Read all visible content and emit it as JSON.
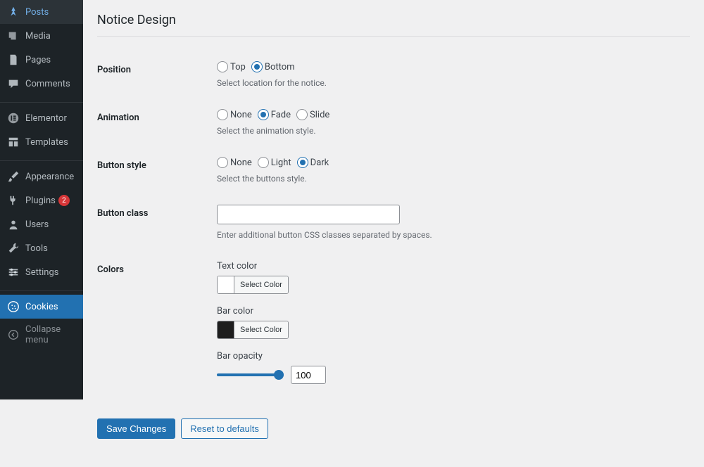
{
  "sidebar": {
    "items": [
      {
        "label": "Posts",
        "icon": "pin"
      },
      {
        "label": "Media",
        "icon": "media"
      },
      {
        "label": "Pages",
        "icon": "page"
      },
      {
        "label": "Comments",
        "icon": "comment"
      }
    ],
    "items2": [
      {
        "label": "Elementor",
        "icon": "elementor"
      },
      {
        "label": "Templates",
        "icon": "templates"
      }
    ],
    "items3": [
      {
        "label": "Appearance",
        "icon": "brush"
      },
      {
        "label": "Plugins",
        "icon": "plug",
        "badge": "2"
      },
      {
        "label": "Users",
        "icon": "user"
      },
      {
        "label": "Tools",
        "icon": "wrench"
      },
      {
        "label": "Settings",
        "icon": "settings"
      }
    ],
    "items4": [
      {
        "label": "Cookies",
        "icon": "cookie"
      }
    ],
    "collapse": "Collapse menu"
  },
  "heading": "Notice Design",
  "fields": {
    "position": {
      "label": "Position",
      "options": [
        "Top",
        "Bottom"
      ],
      "selected": "Bottom",
      "desc": "Select location for the notice."
    },
    "animation": {
      "label": "Animation",
      "options": [
        "None",
        "Fade",
        "Slide"
      ],
      "selected": "Fade",
      "desc": "Select the animation style."
    },
    "button_style": {
      "label": "Button style",
      "options": [
        "None",
        "Light",
        "Dark"
      ],
      "selected": "Dark",
      "desc": "Select the buttons style."
    },
    "button_class": {
      "label": "Button class",
      "value": "",
      "desc": "Enter additional button CSS classes separated by spaces."
    },
    "colors": {
      "label": "Colors",
      "text_color": {
        "label": "Text color",
        "swatch": "#ffffff",
        "btn": "Select Color"
      },
      "bar_color": {
        "label": "Bar color",
        "swatch": "#1e1e1e",
        "btn": "Select Color"
      },
      "bar_opacity": {
        "label": "Bar opacity",
        "value": "100"
      }
    }
  },
  "buttons": {
    "save": "Save Changes",
    "reset": "Reset to defaults"
  }
}
